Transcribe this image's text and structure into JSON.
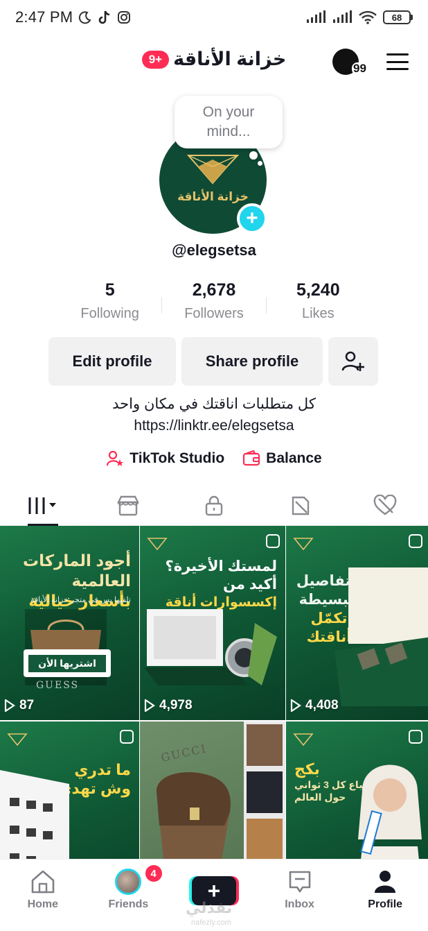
{
  "status_bar": {
    "time": "2:47 PM",
    "battery": "68"
  },
  "header": {
    "title": "خزانة الأناقة",
    "notification_pill": "9+",
    "activity_count": "99"
  },
  "profile": {
    "thought_bubble": "On your mind...",
    "avatar_logo_text": "خزانة الأناقة",
    "username": "@elegsetsa"
  },
  "stats": [
    {
      "value": "5",
      "label": "Following"
    },
    {
      "value": "2,678",
      "label": "Followers"
    },
    {
      "value": "5,240",
      "label": "Likes"
    }
  ],
  "actions": {
    "edit": "Edit profile",
    "share": "Share profile"
  },
  "bio": {
    "text": "كل متطلبات اناقتك في مكان واحد",
    "link": "https://linktr.ee/elegsetsa"
  },
  "links": {
    "studio": "TikTok Studio",
    "balance": "Balance"
  },
  "tabs": [
    "videos-grid",
    "shop",
    "private",
    "reposts",
    "liked"
  ],
  "grid": [
    {
      "views": "87",
      "headline_1": "أجود الماركات العالمية",
      "headline_2": "بأسعار خيالية",
      "sub": "تلقيها بس في متجر خزانة الأناقة",
      "cta": "اشتريها الأن",
      "brand": "GUESS"
    },
    {
      "views": "4,978",
      "headline_1": "لمستك الأخيرة؟",
      "headline_2": "أكيد من",
      "headline_3": "إكسسوارات أناقة"
    },
    {
      "views": "4,408",
      "headline_1": "التفاصيل",
      "headline_2": "البسيطة",
      "headline_3": "تكمّل أناقتك"
    },
    {
      "headline_1": "ما تدري",
      "headline_2": "وش تهدي؟"
    },
    {
      "brand": "GUCCI"
    },
    {
      "headline_1": "بكج",
      "headline_2": "1 يباع كل 3 ثواني",
      "headline_3": "حول العالم"
    }
  ],
  "nav": {
    "home": "Home",
    "friends": "Friends",
    "friends_badge": "4",
    "inbox": "Inbox",
    "profile": "Profile"
  },
  "watermark": {
    "text": "نفذلي",
    "sub": "nafezly.com"
  },
  "colors": {
    "accent": "#fe2c55",
    "cyan": "#20d5ec",
    "brand_green": "#0f4a35"
  }
}
